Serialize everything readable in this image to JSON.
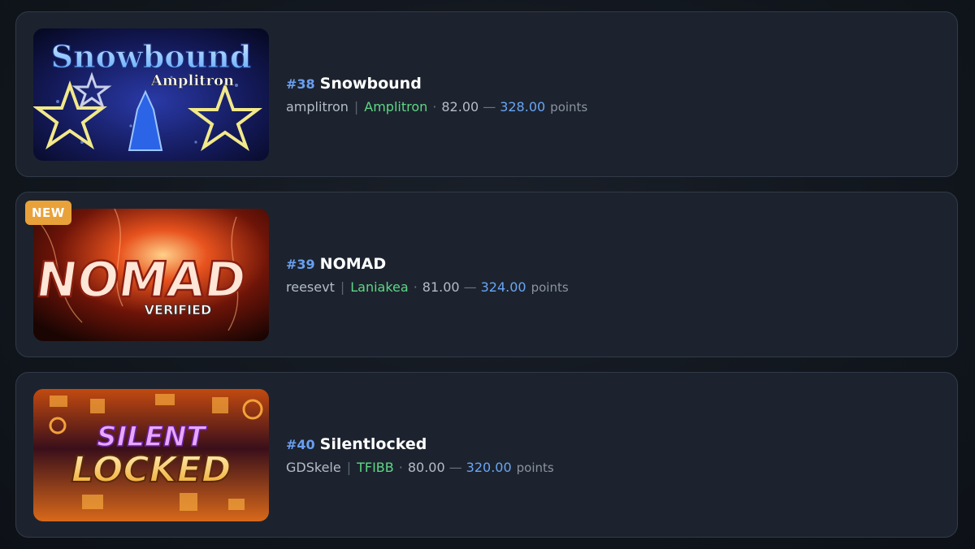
{
  "levels": [
    {
      "rank": "#38",
      "name": "Snowbound",
      "creator": "amplitron",
      "verifier": "Amplitron",
      "score": "82.00",
      "points": "328.00",
      "points_label": "points",
      "badge": "",
      "thumbnail_text": [
        "Snowbound",
        "Amplitron"
      ]
    },
    {
      "rank": "#39",
      "name": "NOMAD",
      "creator": "reesevt",
      "verifier": "Laniakea",
      "score": "81.00",
      "points": "324.00",
      "points_label": "points",
      "badge": "NEW",
      "thumbnail_text": [
        "NOMAD",
        "VERIFIED"
      ]
    },
    {
      "rank": "#40",
      "name": "Silentlocked",
      "creator": "GDSkele",
      "verifier": "TFIBB",
      "score": "80.00",
      "points": "320.00",
      "points_label": "points",
      "badge": "",
      "thumbnail_text": [
        "SILENT",
        "LOCKED"
      ]
    }
  ],
  "separators": {
    "bar": "|",
    "dot": "·",
    "dash": "—"
  },
  "colors": {
    "rank": "#6a9ff0",
    "verifier": "#5fd685",
    "points": "#6aa5f5",
    "badge": "#e9a23a"
  }
}
